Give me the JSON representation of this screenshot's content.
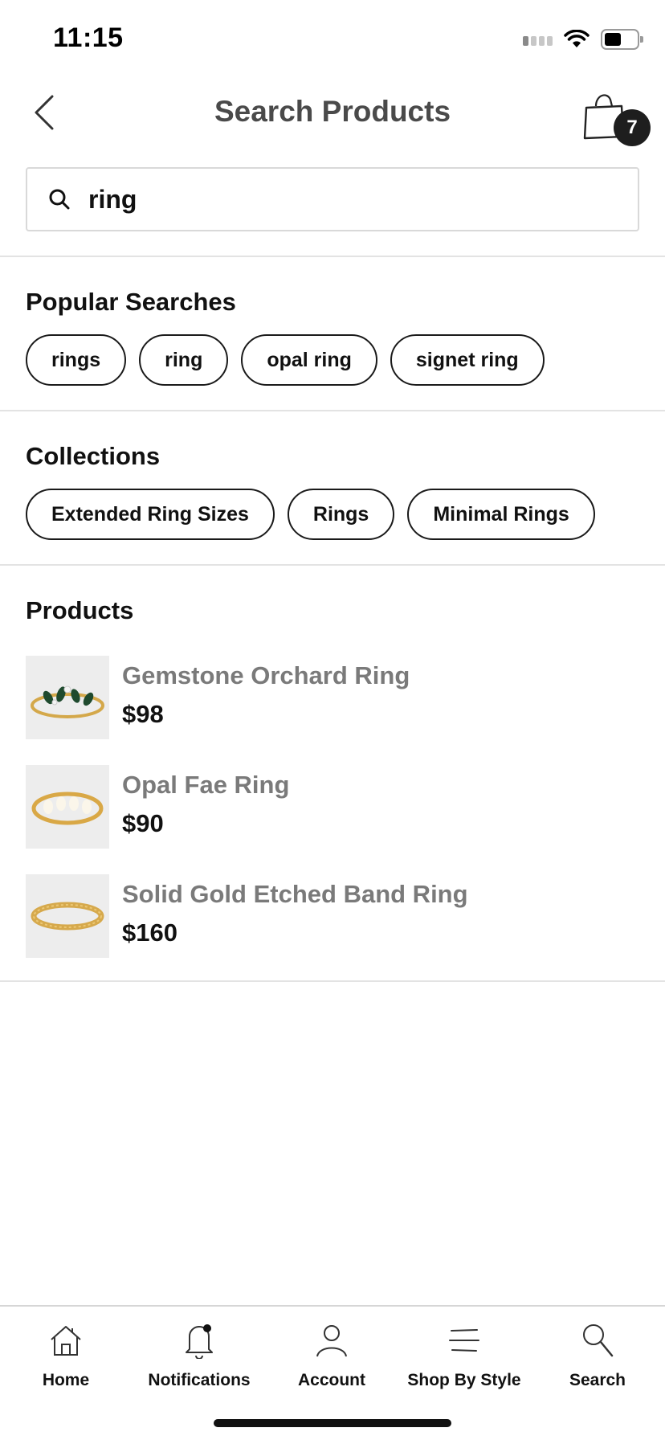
{
  "status_bar": {
    "time": "11:15"
  },
  "header": {
    "title": "Search Products",
    "cart_count": "7"
  },
  "search": {
    "value": "ring"
  },
  "popular_searches": {
    "title": "Popular Searches",
    "items": [
      "rings",
      "ring",
      "opal ring",
      "signet ring"
    ]
  },
  "collections": {
    "title": "Collections",
    "items": [
      "Extended Ring Sizes",
      "Rings",
      "Minimal Rings"
    ]
  },
  "products": {
    "title": "Products",
    "items": [
      {
        "name": "Gemstone Orchard Ring",
        "price": "$98"
      },
      {
        "name": "Opal Fae Ring",
        "price": "$90"
      },
      {
        "name": "Solid Gold Etched Band Ring",
        "price": "$160"
      }
    ]
  },
  "tab_bar": {
    "items": [
      {
        "label": "Home",
        "icon": "home-icon"
      },
      {
        "label": "Notifications",
        "icon": "bell-icon"
      },
      {
        "label": "Account",
        "icon": "person-icon"
      },
      {
        "label": "Shop By Style",
        "icon": "menu-lines-icon"
      },
      {
        "label": "Search",
        "icon": "magnifier-icon"
      }
    ]
  }
}
